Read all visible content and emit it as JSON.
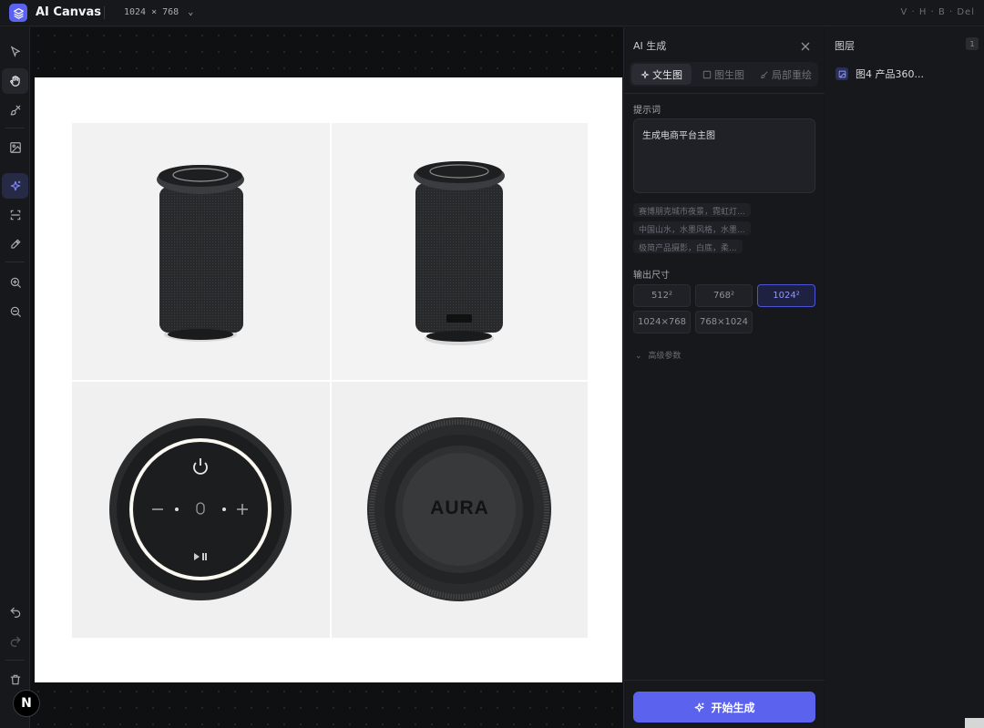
{
  "app": {
    "title": "AI Canvas",
    "canvas_size": "1024 × 768",
    "shortcuts": "V · H · B · Del"
  },
  "toolbar": {
    "tools": [
      {
        "name": "select-tool",
        "icon": "cursor-icon"
      },
      {
        "name": "hand-tool",
        "icon": "hand-icon",
        "active": true
      },
      {
        "name": "brush-tool",
        "icon": "brush-icon"
      },
      {
        "name": "image-tool",
        "icon": "image-icon"
      },
      {
        "name": "ai-generate-tool",
        "icon": "sparkles-icon",
        "accent": true
      },
      {
        "name": "crop-tool",
        "icon": "crop-icon"
      },
      {
        "name": "color-tool",
        "icon": "dropper-icon"
      },
      {
        "name": "zoom-in-tool",
        "icon": "zoom-in-icon"
      },
      {
        "name": "zoom-out-tool",
        "icon": "zoom-out-icon"
      },
      {
        "name": "undo-tool",
        "icon": "undo-icon"
      },
      {
        "name": "redo-tool",
        "icon": "redo-icon"
      },
      {
        "name": "delete-tool",
        "icon": "trash-icon"
      }
    ]
  },
  "canvas": {
    "product_brand": "AURA",
    "badge": "N"
  },
  "ai_panel": {
    "title": "AI 生成",
    "tabs": [
      "文生图",
      "图生图",
      "局部重绘"
    ],
    "prompt_label": "提示词",
    "prompt_value": "生成电商平台主图",
    "suggestions": [
      "赛博朋克城市夜景，霓虹灯...",
      "中国山水，水墨风格，水墨...",
      "极简产品摄影，白底，柔..."
    ],
    "size_label": "输出尺寸",
    "sizes": [
      "512²",
      "768²",
      "1024²",
      "1024×768",
      "768×1024"
    ],
    "selected_size": "1024²",
    "advanced_label": "高级参数",
    "generate_label": "开始生成"
  },
  "layers": {
    "title": "图层",
    "count": "1",
    "items": [
      {
        "name": "图4 产品360..."
      }
    ]
  },
  "colors": {
    "accent": "#5b63ee",
    "bg": "#15161a",
    "panel": "#17181c"
  }
}
